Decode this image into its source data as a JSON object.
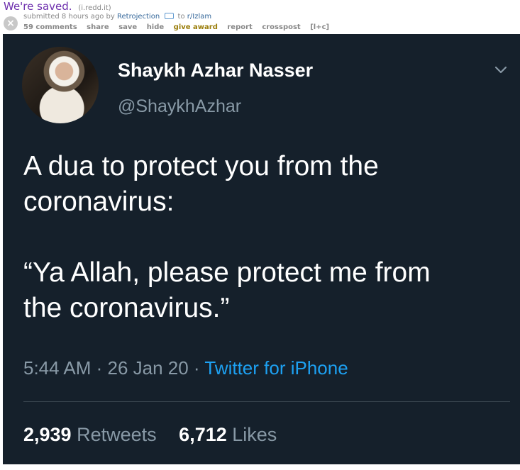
{
  "reddit": {
    "title": "We're saved.",
    "domain": "(i.redd.it)",
    "submitted_text": "submitted 8 hours ago by",
    "author": "Retrojection",
    "to_text": "to",
    "subreddit": "r/Izlam",
    "close_glyph": "×",
    "buttons": [
      "59 comments",
      "share",
      "save",
      "hide",
      "give award",
      "report",
      "crosspost",
      "[l+c]"
    ]
  },
  "tweet": {
    "name": "Shaykh Azhar Nasser",
    "handle": "@ShaykhAzhar",
    "text": "A dua to protect you from the\ncoronavirus:\n\n“Ya Allah, please protect me from\nthe coronavirus.”",
    "time": "5:44 AM · 26 Jan 20 · ",
    "source": "Twitter for iPhone",
    "retweets_count": "2,939",
    "retweets_label": "Retweets",
    "likes_count": "6,712",
    "likes_label": "Likes"
  },
  "colors": {
    "tweet_bg": "#15202b",
    "link_blue": "#1da1f2",
    "muted": "#8899a6",
    "title_purple": "#6d2ead"
  }
}
